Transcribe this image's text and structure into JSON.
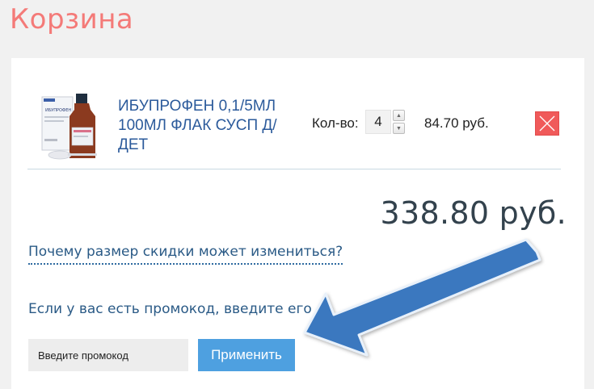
{
  "page": {
    "title": "Корзина"
  },
  "cart": {
    "item": {
      "name": "ИБУПРОФЕН 0,1/5МЛ 100МЛ ФЛАК СУСП Д/ДЕТ",
      "image_label": "ИБУПРОФЕН",
      "quantity_label": "Кол-во:",
      "quantity": "4",
      "price": "84.70 руб."
    },
    "total": "338.80 руб.",
    "discount_link": "Почему размер скидки может измениться?",
    "promo": {
      "hint": "Если у вас есть промокод, введите его",
      "placeholder": "Введите промокод",
      "apply_label": "Применить"
    }
  },
  "icons": {
    "remove": "close-icon",
    "stepper_up": "triangle-up-icon",
    "stepper_down": "triangle-down-icon"
  },
  "colors": {
    "title": "#f47a78",
    "link": "#2b5a9b",
    "remove": "#f05a5a",
    "apply_button": "#4ea0e0",
    "annotation_arrow": "#3a78bf"
  }
}
